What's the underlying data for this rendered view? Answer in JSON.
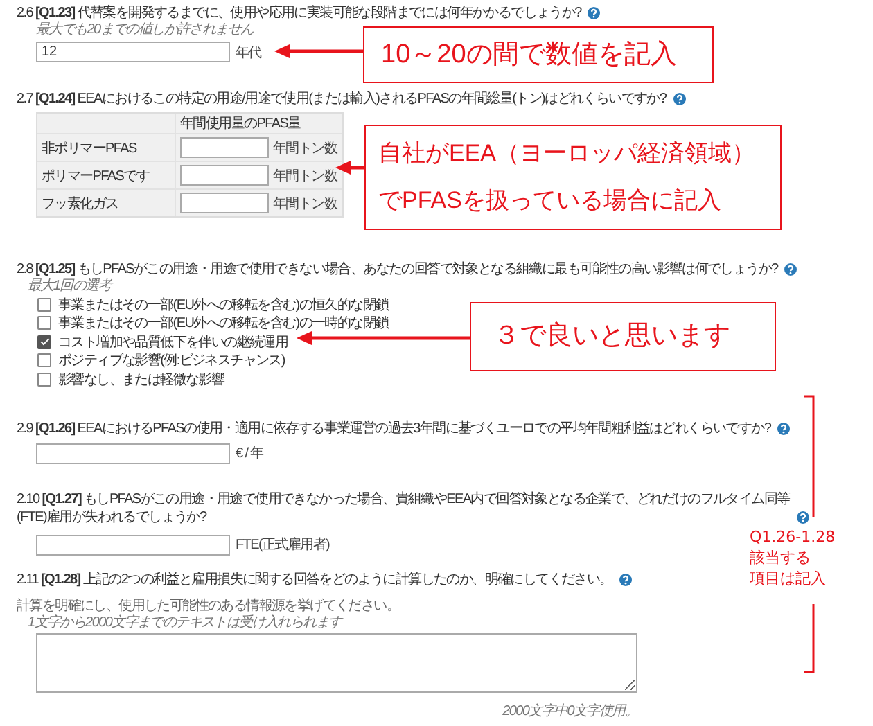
{
  "questions": [
    {
      "kind": "number",
      "number": "2.6",
      "code": "[Q1.23]",
      "text": "代替案を開発するまでに、使用や応用に実装可能な段階までには何年かかるでしょうか?",
      "hint": "最大でも20までの値しか許されません",
      "value": "12",
      "unit": "年代"
    },
    {
      "kind": "table",
      "number": "2.7",
      "code": "[Q1.24]",
      "text": "EEAにおけるこの特定の用途/用途で使用(または輸入)されるPFASの年間総量(トン)はどれくらいですか?",
      "header": "年間使用量のPFAS量",
      "rows": [
        {
          "label": "非ポリマーPFAS",
          "unit": "年間トン数"
        },
        {
          "label": "ポリマーPFASです",
          "unit": "年間トン数"
        },
        {
          "label": "フッ素化ガス",
          "unit": "年間トン数"
        }
      ]
    },
    {
      "kind": "choice",
      "number": "2.8",
      "code": "[Q1.25]",
      "text": "もしPFASがこの用途・用途で使用できない場合、あなたの回答で対象となる組織に最も可能性の高い影響は何でしょうか?",
      "hint": "最大1回の選考",
      "options": [
        {
          "label": "事業またはその一部(EU外への移転を含む)の恒久的な閉鎖",
          "checked": false
        },
        {
          "label": "事業またはその一部(EU外への移転を含む)の一時的な閉鎖",
          "checked": false
        },
        {
          "label": "コスト増加や品質低下を伴いの継続運用",
          "checked": true
        },
        {
          "label": "ポジティブな影響(例:ビジネスチャンス)",
          "checked": false
        },
        {
          "label": "影響なし、または軽微な影響",
          "checked": false
        }
      ]
    },
    {
      "kind": "number",
      "number": "2.9",
      "code": "[Q1.26]",
      "text": "EEAにおけるPFASの使用・適用に依存する事業運営の過去3年間に基づくユーロでの平均年間粗利益はどれくらいですか?",
      "unit": "€ / 年"
    },
    {
      "kind": "number",
      "number": "2.10",
      "code": "[Q1.27]",
      "text": "もしPFASがこの用途・用途で使用できなかった場合、貴組織やEEA内で回答対象となる企業で、どれだけのフルタイム同等(FTE)雇用が失われるでしょうか?",
      "unit": "FTE(正式雇用者)"
    },
    {
      "kind": "textarea",
      "number": "2.11",
      "code": "[Q1.28]",
      "text": "上記の2つの利益と雇用損失に関する回答をどのように計算したのか、明確にしてください。",
      "description": "計算を明確にし、使用した可能性のある情報源を挙げてください。",
      "hint": "1文字から2000文字までのテキストは受け入れられます",
      "counter": "2000文字中0文字使用。"
    }
  ],
  "annotations": {
    "callouts": [
      {
        "lines": [
          "10～20の間で数値を記入"
        ]
      },
      {
        "lines": [
          "自社がEEA（ヨーロッパ経済領域）",
          "でPFASを扱っている場合に記入"
        ]
      },
      {
        "lines": [
          "３で良いと思います"
        ]
      }
    ],
    "bracket_note": {
      "lines": [
        "Q1.26-1.28",
        "該当する",
        "項目は記入"
      ]
    }
  }
}
